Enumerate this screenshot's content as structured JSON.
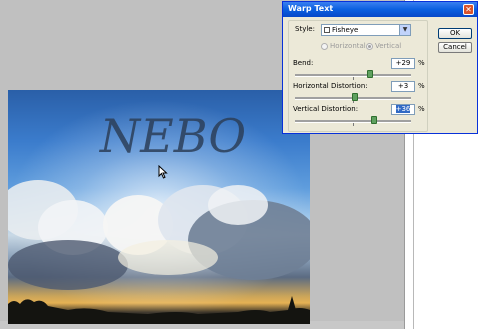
{
  "canvas": {
    "image_text": "NEBO"
  },
  "dialog": {
    "title": "Warp Text",
    "close_glyph": "✕",
    "style_label": "Style:",
    "style_value": "Fisheye",
    "orientation": {
      "horizontal_label": "Horizontal",
      "vertical_label": "Vertical",
      "selected": "Vertical"
    },
    "bend": {
      "label": "Bend:",
      "value": "+29",
      "unit": "%",
      "level_percent": 29
    },
    "horizontal_distortion": {
      "label": "Horizontal Distortion:",
      "value": "+3",
      "unit": "%",
      "level_percent": 3
    },
    "vertical_distortion": {
      "label": "Vertical Distortion:",
      "value": "+36",
      "unit": "%",
      "level_percent": 36
    },
    "ok_label": "OK",
    "cancel_label": "Cancel"
  },
  "colors": {
    "title_bar": "#0a5fe0",
    "dialog_bg": "#ece9d8",
    "slider_thumb": "#5fa05f",
    "selection": "#316ac5"
  },
  "icons": [
    "close-icon",
    "dropdown-arrow-icon",
    "style-icon",
    "arrow-cursor-icon"
  ]
}
